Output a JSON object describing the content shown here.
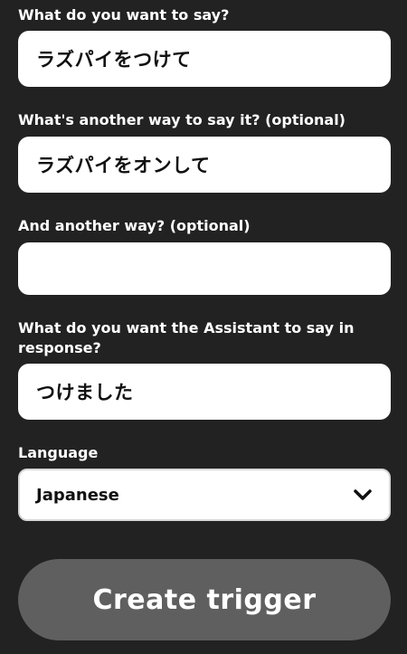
{
  "form": {
    "fields": [
      {
        "label": "What do you want to say?",
        "value": "ラズパイをつけて"
      },
      {
        "label": "What's another way to say it? (optional)",
        "value": "ラズパイをオンして"
      },
      {
        "label": "And another way? (optional)",
        "value": ""
      },
      {
        "label": "What do you want the Assistant to say in response?",
        "value": "つけました"
      }
    ],
    "language": {
      "label": "Language",
      "selected": "Japanese",
      "icon": "chevron-down-icon"
    },
    "submit_label": "Create trigger"
  },
  "colors": {
    "background": "#222222",
    "field_background": "#ffffff",
    "button_background": "#5f5f5f",
    "text_light": "#ffffff",
    "text_dark": "#111111"
  }
}
